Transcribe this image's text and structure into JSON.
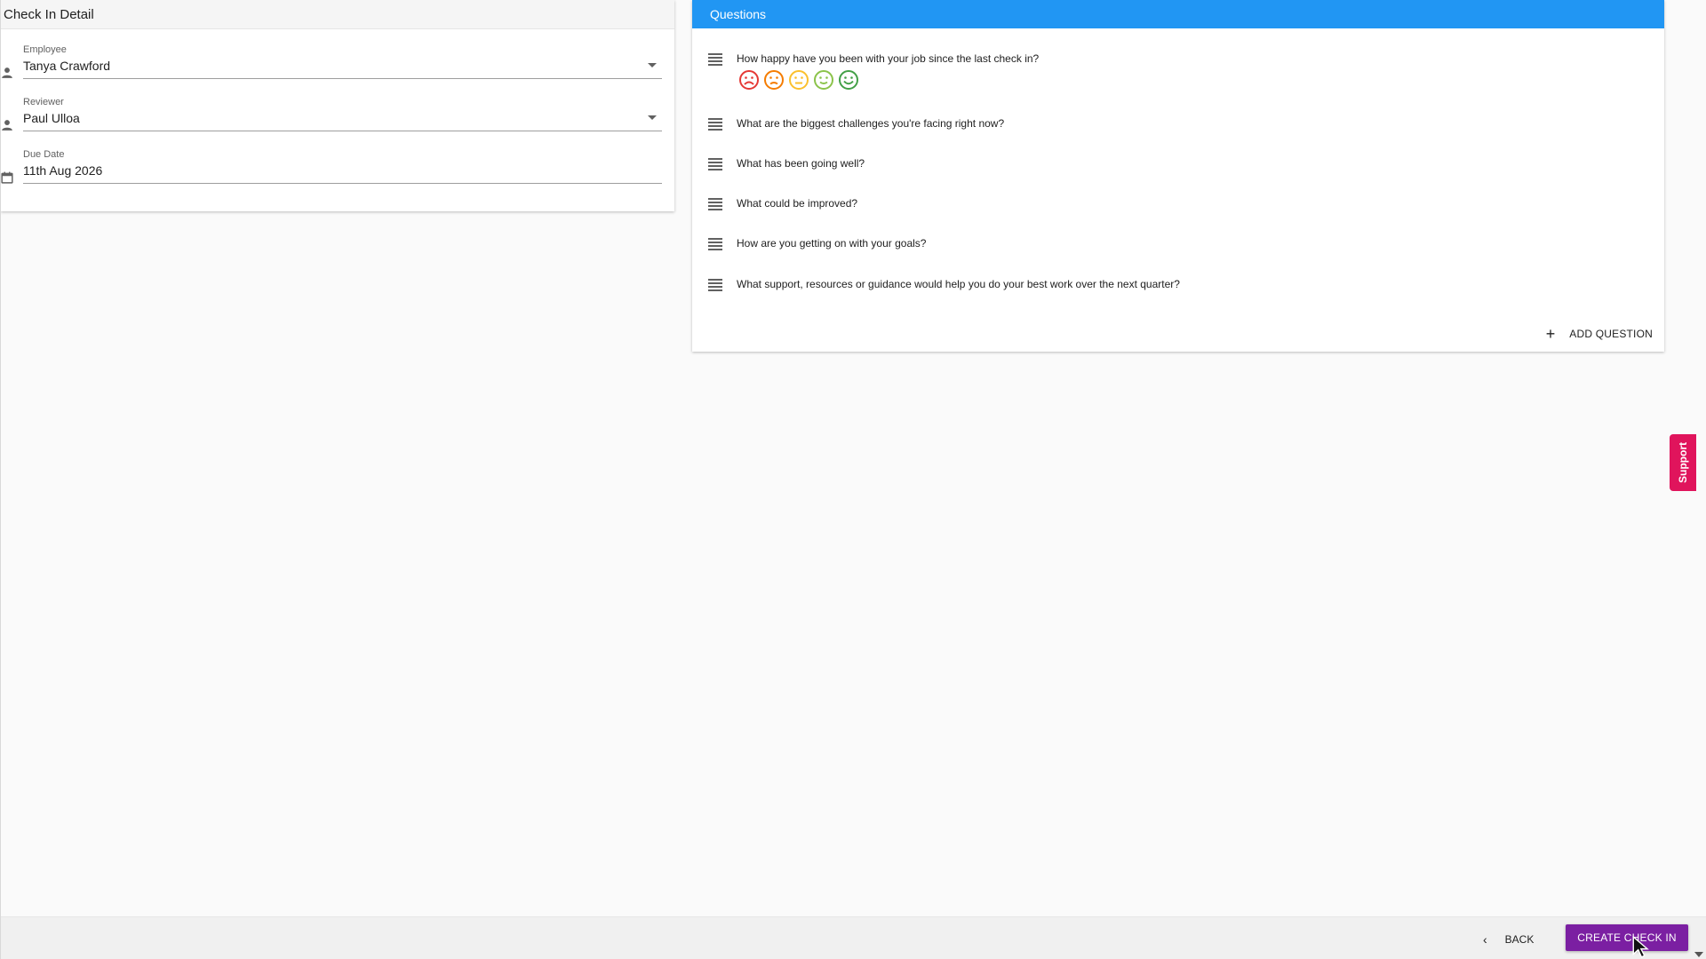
{
  "detail": {
    "title": "Check In Detail",
    "employee": {
      "label": "Employee",
      "value": "Tanya Crawford",
      "icon": "person-icon"
    },
    "reviewer": {
      "label": "Reviewer",
      "value": "Paul Ulloa",
      "icon": "person-icon"
    },
    "due_date": {
      "label": "Due Date",
      "value": "11th Aug 2026",
      "icon": "calendar-icon"
    }
  },
  "questions": {
    "title": "Questions",
    "items": [
      {
        "text": "How happy have you been with your job since the last check in?"
      },
      {
        "text": "What are the biggest challenges you're facing right now?"
      },
      {
        "text": "What has been going well?"
      },
      {
        "text": "What could be improved?"
      },
      {
        "text": "How are you getting on with your goals?"
      },
      {
        "text": "What support, resources or guidance would help you do your best work over the next quarter?"
      }
    ],
    "rating_colors": [
      "#e53935",
      "#f57c00",
      "#fbc02d",
      "#8bc34a",
      "#43a047"
    ],
    "add_label": "ADD QUESTION"
  },
  "support": {
    "label": "Support",
    "color": "#e0145c"
  },
  "footer": {
    "back_label": "BACK",
    "create_label": "CREATE CHECK IN",
    "create_color": "#7b1fa2"
  },
  "header_color": "#2196f3"
}
